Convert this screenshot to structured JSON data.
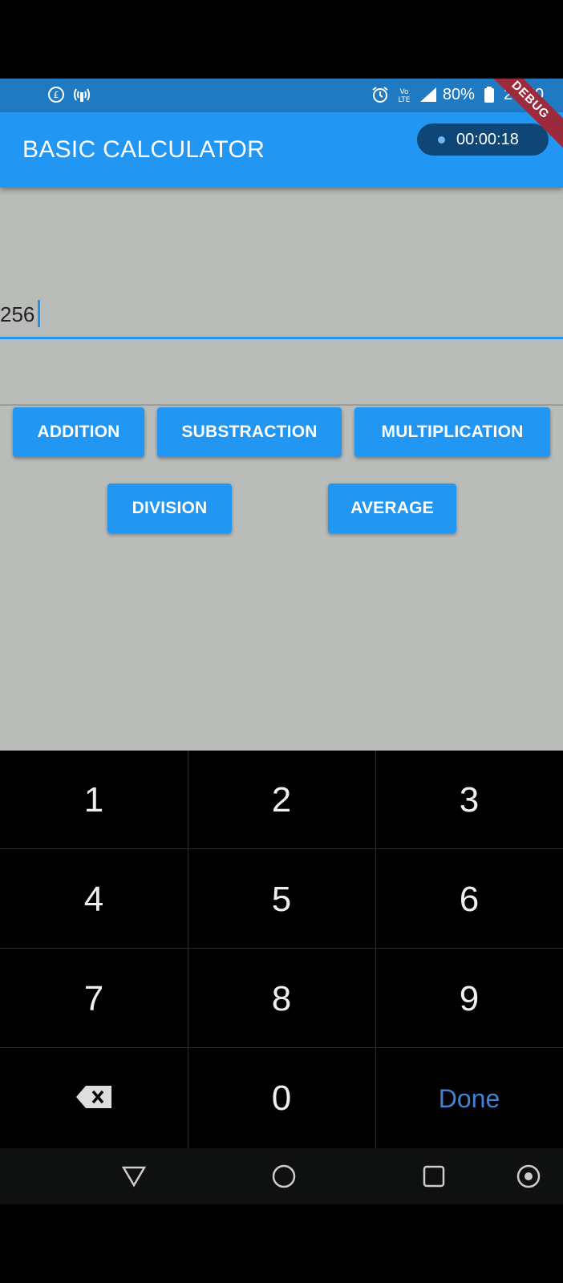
{
  "status_bar": {
    "battery_percent": "80%",
    "time": "23:50",
    "icons_left": [
      "data-saver-icon",
      "hotspot-icon"
    ],
    "icons_right": [
      "alarm-icon",
      "volte-icon",
      "signal-icon",
      "battery-icon"
    ]
  },
  "app_bar": {
    "title": "BASIC CALCULATOR",
    "recording_timer": "00:00:18",
    "debug_banner": "DEBUG"
  },
  "input": {
    "value": "256"
  },
  "buttons": {
    "addition": "ADDITION",
    "subtraction": "SUBSTRACTION",
    "multiplication": "MULTIPLICATION",
    "division": "DIVISION",
    "average": "AVERAGE"
  },
  "keypad": {
    "keys": [
      "1",
      "2",
      "3",
      "4",
      "5",
      "6",
      "7",
      "8",
      "9",
      "0"
    ],
    "done_label": "Done",
    "backspace_icon": "backspace-icon"
  },
  "nav_bar": {
    "icons": [
      "back-icon",
      "home-icon",
      "recents-icon",
      "assistant-icon"
    ]
  },
  "colors": {
    "primary": "#2196f3",
    "status_bar": "#1f7ac2",
    "background": "#b9bcb8",
    "keypad": "#000000",
    "done": "#3f82d6"
  }
}
